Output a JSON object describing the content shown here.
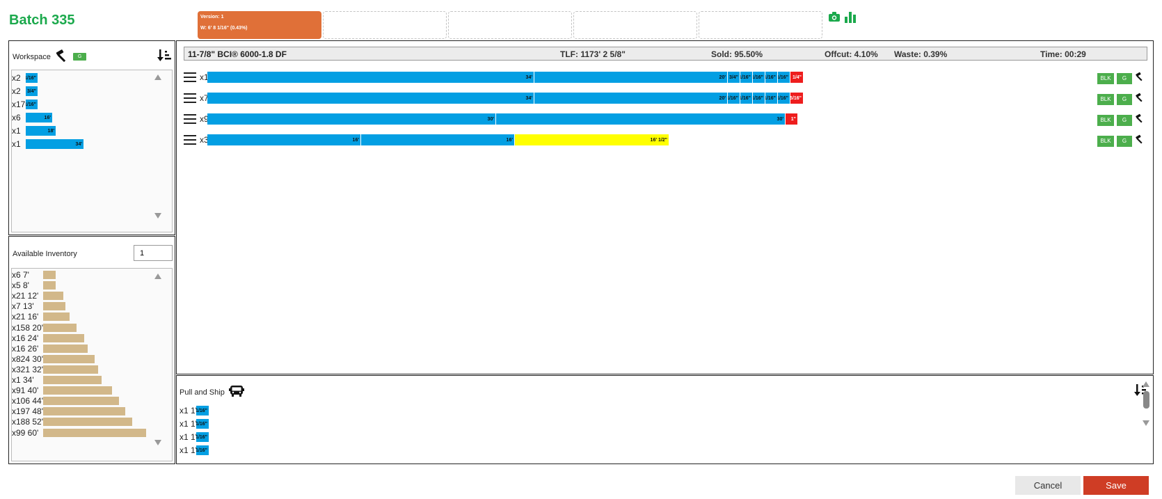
{
  "header": {
    "title": "Batch 335",
    "active_version": {
      "line1": "Version: 1",
      "line2": "W: 6' 8 1/16\" (0.43%)"
    },
    "camera_icon": "camera-icon",
    "chart_icon": "bar-chart-icon"
  },
  "workspace": {
    "title": "Workspace",
    "badge": "G",
    "items": [
      {
        "label": "x2",
        "bar_label": "11/16\""
      },
      {
        "label": "x2",
        "bar_label": "3 3/4\""
      },
      {
        "label": "x17",
        "bar_label": "1/16\""
      },
      {
        "label": "x6",
        "bar_label": "16'"
      },
      {
        "label": "x1",
        "bar_label": "18'"
      },
      {
        "label": "x1",
        "bar_label": "34'"
      }
    ]
  },
  "inventory": {
    "title": "Available Inventory",
    "input_value": "1",
    "items": [
      {
        "label": "x6 7'"
      },
      {
        "label": "x5 8'"
      },
      {
        "label": "x21 12'"
      },
      {
        "label": "x7 13'"
      },
      {
        "label": "x21 16'"
      },
      {
        "label": "x158 20'"
      },
      {
        "label": "x16 24'"
      },
      {
        "label": "x16 26'"
      },
      {
        "label": "x824 30'"
      },
      {
        "label": "x321 32'"
      },
      {
        "label": "x1 34'"
      },
      {
        "label": "x91 40'"
      },
      {
        "label": "x106 44'"
      },
      {
        "label": "x197 48'"
      },
      {
        "label": "x188 52'"
      },
      {
        "label": "x99 60'"
      }
    ]
  },
  "summary": {
    "product": "11-7/8\" BCI® 6000-1.8 DF",
    "tlf": "TLF: 1173' 2 5/8\"",
    "sold": "Sold: 95.50%",
    "offcut": "Offcut: 4.10%",
    "waste": "Waste: 0.39%",
    "time": "Time: 00:29"
  },
  "cuts": [
    {
      "label": "x1 60'",
      "segments": [
        "34'",
        "20'",
        "3/4\"",
        "1/16\"",
        "1/16\"",
        "1/16\"",
        "1/16\"",
        "1/4\""
      ]
    },
    {
      "label": "x7 60'",
      "segments": [
        "34'",
        "20'",
        "1/16\"",
        "1/16\"",
        "1/16\"",
        "1/16\"",
        "1/16\"",
        "5/16\""
      ]
    },
    {
      "label": "x9 60'",
      "segments": [
        "30'",
        "30'",
        "1\""
      ]
    },
    {
      "label": "x3 48'",
      "segments": [
        "16'",
        "16'",
        "16'  1/2\""
      ]
    }
  ],
  "row_actions": {
    "blk": "BLK",
    "g": "G"
  },
  "ship": {
    "title": "Pull and Ship",
    "items": [
      {
        "label": "x1 1'",
        "bar_label": "1/16\""
      },
      {
        "label": "x1 1'",
        "bar_label": "1/16\""
      },
      {
        "label": "x1 1'",
        "bar_label": "1/16\""
      },
      {
        "label": "x1 1'",
        "bar_label": "1/16\""
      }
    ]
  },
  "footer": {
    "cancel": "Cancel",
    "save": "Save"
  },
  "colors": {
    "accent_green": "#1ba94c",
    "cut_blue": "#039fe3",
    "waste_red": "#ee1d1d",
    "offcut_yellow": "#ffff00",
    "inventory_tan": "#d2b88a",
    "active_version": "#e07038",
    "save_red": "#cf3d25"
  }
}
